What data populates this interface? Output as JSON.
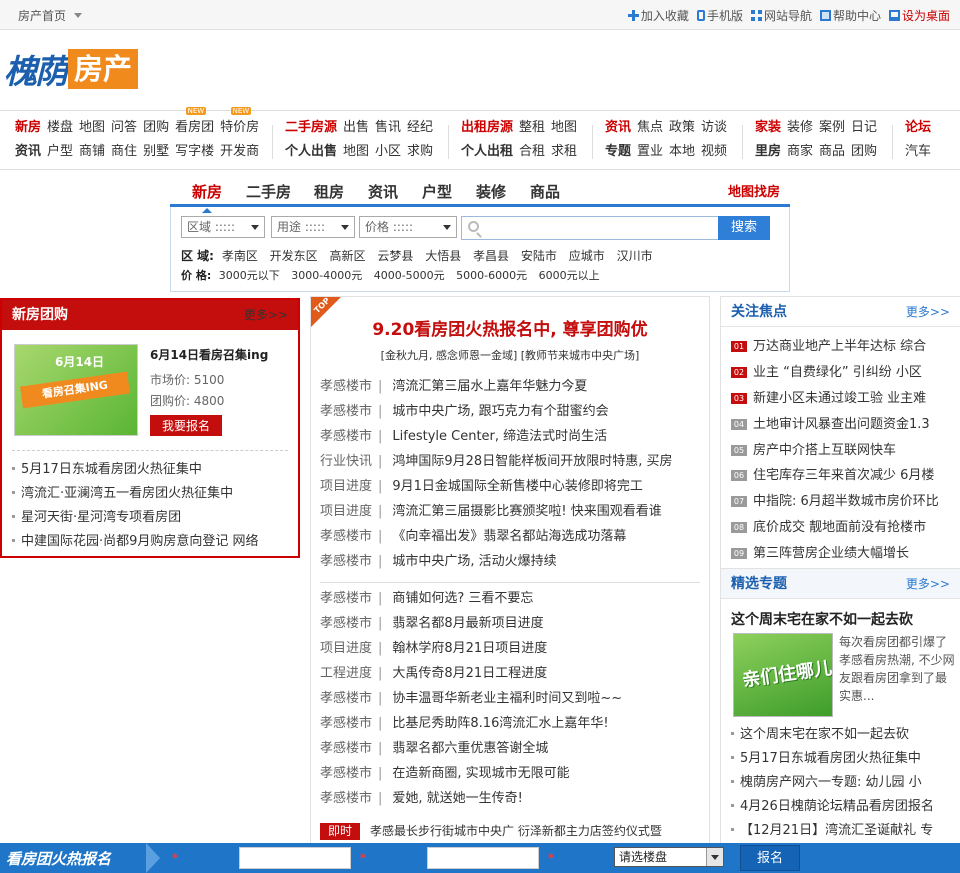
{
  "topbar": {
    "home": "房产首页",
    "tools": [
      {
        "label": "加入收藏",
        "icon": "plus-icon"
      },
      {
        "label": "手机版",
        "icon": "phone-icon"
      },
      {
        "label": "网站导航",
        "icon": "grid-icon"
      },
      {
        "label": "帮助中心",
        "icon": "book-icon"
      },
      {
        "label": "设为桌面",
        "icon": "desktop-icon"
      }
    ]
  },
  "logo": {
    "brand": "槐荫",
    "tag": "房产"
  },
  "channels": [
    {
      "row1": [
        "新房",
        "楼盘",
        "地图",
        "问答",
        "团购",
        "看房团",
        "特价房"
      ],
      "row2": [
        "资讯",
        "户型",
        "商铺",
        "商住",
        "别墅",
        "写字楼",
        "开发商"
      ],
      "new_badge": "NEW"
    },
    {
      "row1": [
        "二手房源",
        "出售",
        "售讯",
        "经纪"
      ],
      "row2": [
        "个人出售",
        "地图",
        "小区",
        "求购"
      ]
    },
    {
      "row1": [
        "出租房源",
        "整租",
        "地图"
      ],
      "row2": [
        "个人出租",
        "合租",
        "求租"
      ]
    },
    {
      "row1": [
        "资讯",
        "焦点",
        "政策",
        "访谈"
      ],
      "row2": [
        "专题",
        "置业",
        "本地",
        "视频"
      ]
    },
    {
      "row1": [
        "家装",
        "装修",
        "案例",
        "日记"
      ],
      "row2": [
        "里房",
        "商家",
        "商品",
        "团购"
      ]
    },
    {
      "row1": [
        "论坛"
      ],
      "row2": [
        "汽车"
      ]
    }
  ],
  "search": {
    "tabs": [
      "新房",
      "二手房",
      "租房",
      "资讯",
      "户型",
      "装修",
      "商品"
    ],
    "map_link": "地图找房",
    "selects": [
      "区域 :::::",
      "用途 :::::",
      "价格 :::::"
    ],
    "button": "搜索",
    "area_label": "区 域:",
    "areas": [
      "孝南区",
      "开发东区",
      "高新区",
      "云梦县",
      "大悟县",
      "孝昌县",
      "安陆市",
      "应城市",
      "汉川市"
    ],
    "price_label": "价 格:",
    "prices": [
      "3000元以下",
      "3000-4000元",
      "4000-5000元",
      "5000-6000元",
      "6000元以上"
    ]
  },
  "tuan": {
    "title": "新房团购",
    "more": "更多>>",
    "pic_date": "6月14日",
    "pic_band": "看房召集ING",
    "item_title": "6月14日看房召集ing",
    "market_price": "市场价: 5100",
    "group_price": "团购价: 4800",
    "signup": "我要报名",
    "list": [
      "5月17日东城看房团火热征集中",
      "湾流汇·亚澜湾五一看房团火热征集中",
      "星河天街·星河湾专项看房团",
      "中建国际花园·尚都9月购房意向登记 网络"
    ]
  },
  "news": {
    "top": "TOP",
    "headline": "9.20看房团火热报名中, 尊享团购优",
    "sub": "[金秋九月, 感念师恩一金域] [教师节来城市中央广场]",
    "list1": [
      {
        "cat": "孝感楼市",
        "title": "湾流汇第三届水上嘉年华魅力今夏"
      },
      {
        "cat": "孝感楼市",
        "title": "城市中央广场, 跟巧克力有个甜蜜约会"
      },
      {
        "cat": "孝感楼市",
        "title": "Lifestyle Center, 缔造法式时尚生活"
      },
      {
        "cat": "行业快讯",
        "title": "鸿坤国际9月28日智能样板间开放限时特惠, 买房"
      },
      {
        "cat": "项目进度",
        "title": "9月1日金城国际全新售楼中心装修即将完工"
      },
      {
        "cat": "项目进度",
        "title": "湾流汇第三届摄影比赛颁奖啦! 快来围观看看谁"
      },
      {
        "cat": "孝感楼市",
        "title": "《向幸福出发》翡翠名都站海选成功落幕"
      },
      {
        "cat": "孝感楼市",
        "title": "城市中央广场, 活动火爆持续"
      }
    ],
    "list2": [
      {
        "cat": "孝感楼市",
        "title": "商铺如何选? 三看不要忘"
      },
      {
        "cat": "孝感楼市",
        "title": "翡翠名都8月最新项目进度"
      },
      {
        "cat": "项目进度",
        "title": "翰林学府8月21日项目进度"
      },
      {
        "cat": "工程进度",
        "title": "大禹传奇8月21日工程进度"
      },
      {
        "cat": "孝感楼市",
        "title": "协丰温哥华新老业主福利时间又到啦~~"
      },
      {
        "cat": "孝感楼市",
        "title": "比基尼秀助阵8.16湾流汇水上嘉年华!"
      },
      {
        "cat": "孝感楼市",
        "title": "翡翠名都六重优惠答谢全城"
      },
      {
        "cat": "孝感楼市",
        "title": "在造新商圈, 实现城市无限可能"
      },
      {
        "cat": "孝感楼市",
        "title": "爱她, 就送她一生传奇!"
      }
    ],
    "flash_tag": "即时",
    "flash_text": "孝感最长步行街城市中央广 衍泽新都主力店签约仪式暨"
  },
  "focus": {
    "title": "关注焦点",
    "more": "更多>>",
    "items": [
      {
        "num": "01",
        "text": "万达商业地产上半年达标 综合"
      },
      {
        "num": "02",
        "text": "业主 “自费绿化” 引纠纷 小区"
      },
      {
        "num": "03",
        "text": "新建小区未通过竣工验 业主难"
      },
      {
        "num": "04",
        "text": "土地审计风暴查出问题资金1.3"
      },
      {
        "num": "05",
        "text": "房产中介搭上互联网快车"
      },
      {
        "num": "06",
        "text": "住宅库存三年来首次减少 6月楼"
      },
      {
        "num": "07",
        "text": "中指院: 6月超半数城市房价环比"
      },
      {
        "num": "08",
        "text": "底价成交 靓地面前没有抢楼市"
      },
      {
        "num": "09",
        "text": "第三阵营房企业绩大幅增长"
      }
    ]
  },
  "topic": {
    "title": "精选专题",
    "more": "更多>>",
    "feature_title": "这个周末宅在家不如一起去砍",
    "pic_text": "亲们住哪儿",
    "desc": "每次看房团都引爆了孝感看房热潮, 不少网友跟看房团拿到了最实惠...",
    "list": [
      "这个周末宅在家不如一起去砍",
      "5月17日东城看房团火热征集中",
      "槐荫房产网六一专题: 幼儿园 小",
      "4月26日槐荫论坛精品看房团报名",
      "【12月21日】湾流汇圣诞献礼 专"
    ]
  },
  "signup_bar": {
    "label": "看房团火热报名",
    "star": "*",
    "select": "请选楼盘",
    "button": "报名"
  }
}
